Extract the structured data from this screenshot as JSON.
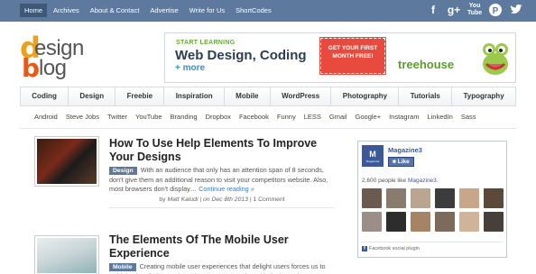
{
  "topnav": {
    "items": [
      {
        "label": "Home",
        "active": true
      },
      {
        "label": "Archives"
      },
      {
        "label": "About & Contact"
      },
      {
        "label": "Advertise"
      },
      {
        "label": "Write for Us"
      },
      {
        "label": "ShortCodes"
      }
    ]
  },
  "social": {
    "icons": [
      "facebook-icon",
      "google-plus-icon",
      "youtube-icon",
      "pinterest-icon",
      "twitter-icon"
    ],
    "labels": {
      "facebook": "f",
      "googleplus": "g+",
      "youtube": "You Tube",
      "pinterest": "P",
      "twitter": "t"
    }
  },
  "logo": {
    "text_design": "esign",
    "text_blog": "log",
    "letter_d": "d",
    "letter_b": "b"
  },
  "ad": {
    "start": "START LEARNING",
    "title": "Web Design, Coding",
    "more": "+ more",
    "cta": "GET YOUR FIRST MONTH FREE!",
    "brand": "treehouse"
  },
  "categories": [
    "Coding",
    "Design",
    "Freebie",
    "Inspiration",
    "Mobile",
    "WordPress",
    "Photography",
    "Tutorials",
    "Typography"
  ],
  "tags": [
    "Android",
    "Steve Jobs",
    "Twitter",
    "YouTube",
    "Branding",
    "Dropbox",
    "Facebook",
    "Funny",
    "LESS",
    "Gmail",
    "Google+",
    "Instagram",
    "LinkedIn",
    "Sass"
  ],
  "posts": [
    {
      "title": "How To Use Help Elements To Improve Your Designs",
      "category": "Design",
      "excerpt": "With an audience that only has an attention span of 8 seconds, don't give them an additional reason to visit your competitors website. Also, most browsers don't display…",
      "more": "Continue reading »",
      "byline_prefix": "by",
      "author": "Matt Kaludi",
      "sep1": "|",
      "date": "on Dec 8th 2013",
      "sep2": "|",
      "comments": "1 Comment"
    },
    {
      "title": "The Elements Of The Mobile User Experience",
      "category": "Mobile",
      "excerpt": "Creating mobile user experiences that delight users forces us to rethink a lot of what we have been accustomed to with desktop sites"
    }
  ],
  "facebook": {
    "logo": "M",
    "logo_sub": "Magazine3",
    "page_name": "Magazine3",
    "like_label": "Like",
    "count": "2,600",
    "count_text": "people like",
    "count_page": "Magazine3.",
    "plugin_label": "Facebook social plugin",
    "face_colors": [
      "#6b5a4e",
      "#8a7b6f",
      "#b9a590",
      "#3c3c3c",
      "#c7a68a",
      "#5b4a3a",
      "#9a8e86",
      "#2d2d2d",
      "#a48465",
      "#7c6a5a",
      "#d0b49a",
      "#47403a"
    ]
  }
}
